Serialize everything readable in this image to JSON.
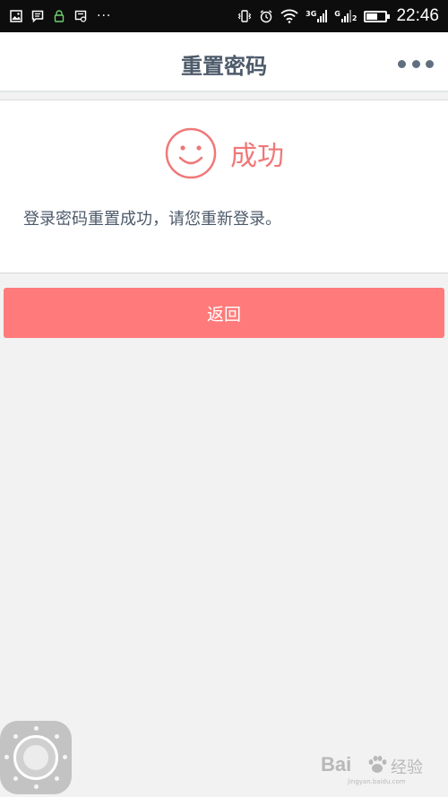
{
  "status_bar": {
    "time": "22:46",
    "network_label": "3G",
    "sim_label": "G",
    "sim_index": "2",
    "more": "···",
    "battery_percent": 60,
    "icons": [
      "image-icon",
      "message-icon",
      "lock-app-icon",
      "screenshot-icon",
      "vibrate-icon",
      "alarm-icon",
      "wifi-icon",
      "signal-icon",
      "signal-2-icon",
      "battery-icon"
    ]
  },
  "nav": {
    "title": "重置密码",
    "more_icon": "more-dots-icon"
  },
  "result": {
    "icon": "smile-icon",
    "title": "成功",
    "message": "登录密码重置成功，请您重新登录。"
  },
  "actions": {
    "back_label": "返回"
  },
  "watermark": {
    "brand": "Bai",
    "suffix": "经验",
    "url": "jingyan.baidu.com"
  },
  "colors": {
    "accent": "#ff7b7b",
    "success_text": "#f07878",
    "title_text": "#4d5a6a",
    "page_background": "#f2f2f2"
  }
}
